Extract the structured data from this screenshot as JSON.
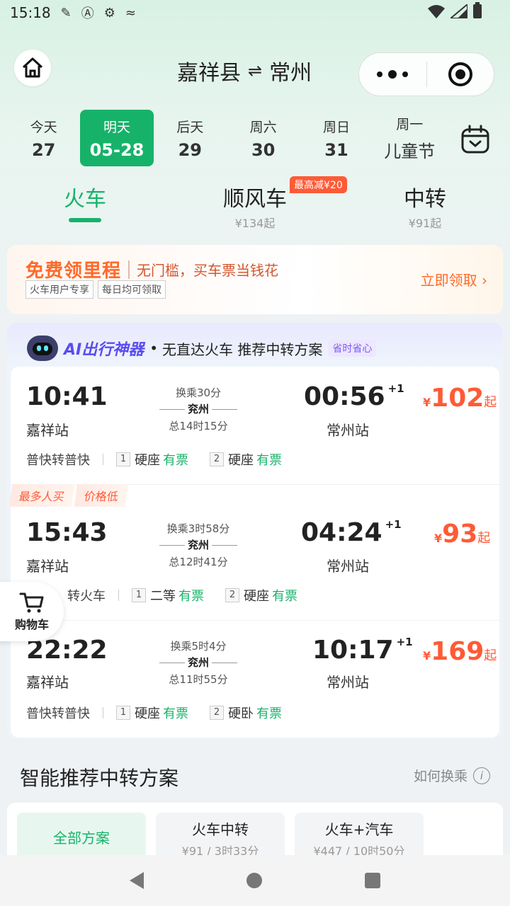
{
  "status_bar": {
    "time": "15:18",
    "icons": [
      "bandage-icon",
      "a-icon",
      "gear-icon",
      "tune-icon"
    ]
  },
  "header": {
    "origin": "嘉祥县",
    "swap_symbol": "⇌",
    "destination": "常州"
  },
  "dates": [
    {
      "weekday": "今天",
      "day": "27"
    },
    {
      "weekday": "明天",
      "day": "05-28",
      "active": true
    },
    {
      "weekday": "后天",
      "day": "29"
    },
    {
      "weekday": "周六",
      "day": "30"
    },
    {
      "weekday": "周日",
      "day": "31"
    },
    {
      "weekday": "周一",
      "day": "儿童节"
    }
  ],
  "modes": [
    {
      "label": "火车",
      "sub": ""
    },
    {
      "label": "顺风车",
      "sub": "¥134起",
      "badge": "最高减¥20"
    },
    {
      "label": "中转",
      "sub": "¥91起"
    }
  ],
  "banner": {
    "main": "免费领里程",
    "sub": "无门槛，买车票当钱花",
    "tags": [
      "火车用户专享",
      "每日均可领取"
    ],
    "claim": "立即领取"
  },
  "ai": {
    "title": "AI出行神器",
    "dot": "•",
    "desc": "无直达火车 推荐中转方案",
    "tag": "省时省心"
  },
  "trips": [
    {
      "dep_time": "10:41",
      "dep_station": "嘉祥站",
      "transfer": "换乘30分",
      "hub": "兖州",
      "total": "总14时15分",
      "arr_time": "00:56",
      "arr_plus": "+1",
      "arr_station": "常州站",
      "currency": "¥",
      "price": "102",
      "price_suffix": "起",
      "train_type": "普快转普快",
      "seg1_num": "1",
      "seg1_seat": "硬座",
      "seg1_avail": "有票",
      "seg2_num": "2",
      "seg2_seat": "硬座",
      "seg2_avail": "有票"
    },
    {
      "dep_time": "15:43",
      "dep_station": "嘉祥站",
      "transfer": "换乘3时58分",
      "hub": "兖州",
      "total": "总12时41分",
      "arr_time": "04:24",
      "arr_plus": "+1",
      "arr_station": "常州站",
      "currency": "¥",
      "price": "93",
      "price_suffix": "起",
      "train_type": "转火车",
      "seg1_num": "1",
      "seg1_seat": "二等",
      "seg1_avail": "有票",
      "seg2_num": "2",
      "seg2_seat": "硬座",
      "seg2_avail": "有票",
      "tags": [
        "最多人买",
        "价格低"
      ]
    },
    {
      "dep_time": "22:22",
      "dep_station": "嘉祥站",
      "transfer": "换乘5时4分",
      "hub": "兖州",
      "total": "总11时55分",
      "arr_time": "10:17",
      "arr_plus": "+1",
      "arr_station": "常州站",
      "currency": "¥",
      "price": "169",
      "price_suffix": "起",
      "train_type": "普快转普快",
      "seg1_num": "1",
      "seg1_seat": "硬座",
      "seg1_avail": "有票",
      "seg2_num": "2",
      "seg2_seat": "硬卧",
      "seg2_avail": "有票"
    }
  ],
  "cart": {
    "label": "购物车"
  },
  "smart": {
    "title": "智能推荐中转方案",
    "how_to": "如何换乘",
    "info_glyph": "i",
    "options": [
      {
        "label": "全部方案",
        "sub": ""
      },
      {
        "label": "火车中转",
        "sub": "¥91 / 3时33分"
      },
      {
        "label": "火车+汽车",
        "sub": "¥447 / 10时50分"
      }
    ]
  },
  "colors": {
    "accent": "#17b26a",
    "price": "#ff5a36",
    "ai": "#5a4cf0"
  }
}
